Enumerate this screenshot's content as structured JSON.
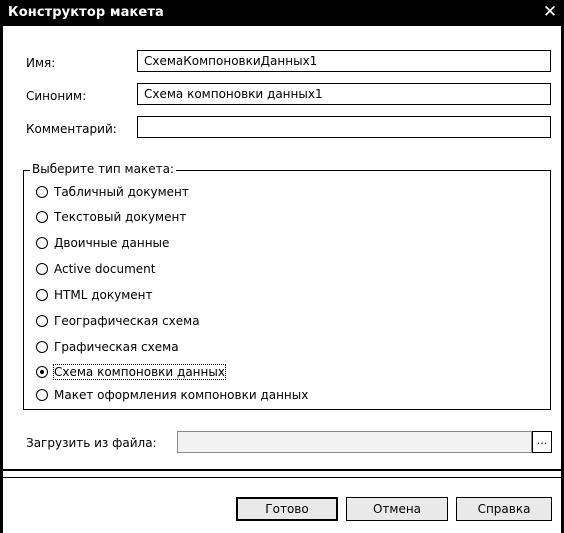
{
  "window": {
    "title": "Конструктор макета",
    "close_glyph": "✕"
  },
  "form": {
    "name_label": "Имя:",
    "name_value": "СхемаКомпоновкиДанных1",
    "synonym_label": "Синоним:",
    "synonym_value": "Схема компоновки данных1",
    "comment_label": "Комментарий:",
    "comment_value": ""
  },
  "type_group": {
    "title": "Выберите тип макета:",
    "options": [
      {
        "label": "Табличный документ",
        "checked": false
      },
      {
        "label": "Текстовый документ",
        "checked": false
      },
      {
        "label": "Двоичные данные",
        "checked": false
      },
      {
        "label": "Active document",
        "checked": false
      },
      {
        "label": "HTML документ",
        "checked": false
      },
      {
        "label": "Географическая схема",
        "checked": false
      },
      {
        "label": "Графическая схема",
        "checked": false
      },
      {
        "label": "Схема компоновки данных",
        "checked": true
      },
      {
        "label": "Макет оформления компоновки данных",
        "checked": false
      }
    ]
  },
  "load": {
    "label": "Загрузить из файла:",
    "value": "",
    "browse_label": "..."
  },
  "buttons": {
    "ok": "Готово",
    "cancel": "Отмена",
    "help": "Справка"
  }
}
